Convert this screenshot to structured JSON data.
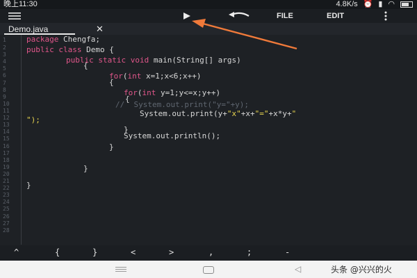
{
  "status_bar": {
    "time": "晚上11:30",
    "network_speed": "4.8K/s",
    "battery_level": 0.65
  },
  "toolbar": {
    "run_icon": "play-triangle",
    "undo_icon": "curved-undo-arrow",
    "file_label": "FILE",
    "edit_label": "EDIT",
    "more_icon": "vertical-ellipsis"
  },
  "tab": {
    "label": "Demo.java",
    "close_glyph": "✕"
  },
  "editor": {
    "line_numbers": [
      "1",
      "2",
      "3",
      "4",
      "5",
      "6",
      "7",
      "8",
      "9",
      "10",
      "11",
      "12",
      "13",
      "14",
      "15",
      "16",
      "17",
      "18",
      "19",
      "20",
      "21",
      "22",
      "23",
      "24",
      "25",
      "26",
      "27",
      "28"
    ],
    "code": [
      "package Chengfa;",
      "public class Demo {",
      "public static void main(String[] args)",
      "{",
      "for(int x=1;x<6;x++)",
      "{",
      "for(int y=1;y<=x;y++)",
      "{",
      "//  System.out.print(\"y=\"+y);",
      "System.out.print(y+\"x\"+x+\"=\"+x*y+\"",
      "\");",
      "}",
      "System.out.println();",
      "}",
      "}",
      "}"
    ]
  },
  "symbols": [
    "^",
    "{",
    "}",
    "<",
    ">",
    ",",
    ";",
    "-"
  ],
  "navbar": {
    "back_glyph": "◁"
  },
  "watermark": "头条 @兴兴的火",
  "colors": {
    "background": "#1e2125",
    "keyword": "#e0568a",
    "string": "#e6d34e",
    "comment": "#5f6670",
    "annotation_arrow": "#f07a3a"
  }
}
